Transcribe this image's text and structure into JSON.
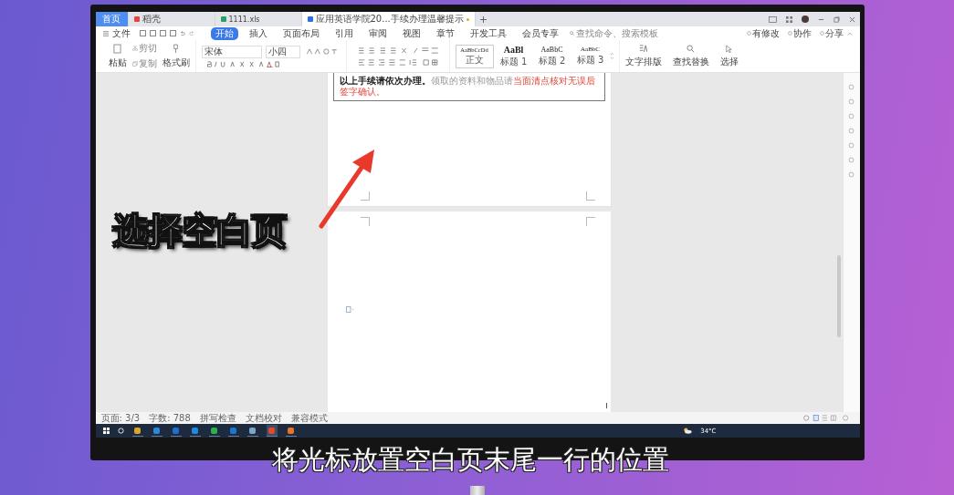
{
  "captions": {
    "top": "选择空白页",
    "bottom": "将光标放置空白页末尾一行的位置"
  },
  "tabs": [
    {
      "label": "首页",
      "kind": "home",
      "selected": false
    },
    {
      "label": "稻壳",
      "kind": "docer",
      "selected": false
    },
    {
      "label": "1111.xls",
      "kind": "sheet",
      "selected": false
    },
    {
      "label": "应用英语学院20...手续办理温馨提示",
      "kind": "doc",
      "selected": true
    }
  ],
  "menu": {
    "file": "文件",
    "items": [
      {
        "label": "开始",
        "selected": true
      },
      {
        "label": "插入",
        "selected": false
      },
      {
        "label": "页面布局",
        "selected": false
      },
      {
        "label": "引用",
        "selected": false
      },
      {
        "label": "审阅",
        "selected": false
      },
      {
        "label": "视图",
        "selected": false
      },
      {
        "label": "章节",
        "selected": false
      },
      {
        "label": "开发工具",
        "selected": false
      },
      {
        "label": "会员专享",
        "selected": false
      }
    ],
    "search": {
      "placeholder": "查找命令、搜索模板"
    },
    "actions": [
      "有修改",
      "协作",
      "分享"
    ]
  },
  "ribbon": {
    "clipboard": [
      "粘贴",
      "剪切",
      "复制",
      "格式刷"
    ],
    "font": {
      "value": "宋体"
    },
    "size": {
      "value": "小四"
    },
    "styles": [
      {
        "sample": "AaBbCcDd",
        "label": "正文"
      },
      {
        "sample": "AaBl",
        "label": "标题 1"
      },
      {
        "sample": "AaBbC",
        "label": "标题 2"
      },
      {
        "sample": "AaBbC",
        "label": "标题 3"
      }
    ],
    "tools": [
      "文字排版",
      "查找替换",
      "选择"
    ]
  },
  "document": {
    "note": [
      {
        "text": "以上手续请依次办理。",
        "kind": "bold"
      },
      {
        "text": "领取的资料和物品请",
        "kind": "muted"
      },
      {
        "text": "当面清点核对无误后签字确认。",
        "kind": "alert"
      }
    ]
  },
  "status_bar": [
    "页面: 3/3",
    "字数: 788",
    "拼写检查",
    "文档校对",
    "兼容模式"
  ],
  "taskbar": {
    "temperature": "34°C"
  }
}
